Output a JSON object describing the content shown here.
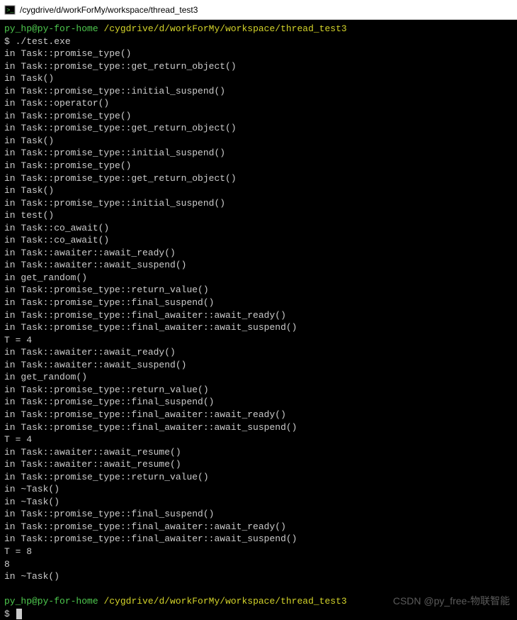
{
  "window": {
    "title": "/cygdrive/d/workForMy/workspace/thread_test3"
  },
  "prompt1": {
    "user_host": "py_hp@py-for-home",
    "cwd": "/cygdrive/d/workForMy/workspace/thread_test3"
  },
  "command1": "$ ./test.exe",
  "output_lines": [
    "in Task::promise_type()",
    "in Task::promise_type::get_return_object()",
    "in Task()",
    "in Task::promise_type::initial_suspend()",
    "in Task::operator()",
    "in Task::promise_type()",
    "in Task::promise_type::get_return_object()",
    "in Task()",
    "in Task::promise_type::initial_suspend()",
    "in Task::promise_type()",
    "in Task::promise_type::get_return_object()",
    "in Task()",
    "in Task::promise_type::initial_suspend()",
    "in test()",
    "in Task::co_await()",
    "in Task::co_await()",
    "in Task::awaiter::await_ready()",
    "in Task::awaiter::await_suspend()",
    "in get_random()",
    "in Task::promise_type::return_value()",
    "in Task::promise_type::final_suspend()",
    "in Task::promise_type::final_awaiter::await_ready()",
    "in Task::promise_type::final_awaiter::await_suspend()",
    "T = 4",
    "in Task::awaiter::await_ready()",
    "in Task::awaiter::await_suspend()",
    "in get_random()",
    "in Task::promise_type::return_value()",
    "in Task::promise_type::final_suspend()",
    "in Task::promise_type::final_awaiter::await_ready()",
    "in Task::promise_type::final_awaiter::await_suspend()",
    "T = 4",
    "in Task::awaiter::await_resume()",
    "in Task::awaiter::await_resume()",
    "in Task::promise_type::return_value()",
    "in ~Task()",
    "in ~Task()",
    "in Task::promise_type::final_suspend()",
    "in Task::promise_type::final_awaiter::await_ready()",
    "in Task::promise_type::final_awaiter::await_suspend()",
    "T = 8",
    "8",
    "in ~Task()"
  ],
  "prompt2": {
    "user_host": "py_hp@py-for-home",
    "cwd": "/cygdrive/d/workForMy/workspace/thread_test3"
  },
  "prompt2_dollar": "$ ",
  "blank_before_prompt2": "",
  "watermark": "CSDN @py_free-物联智能"
}
